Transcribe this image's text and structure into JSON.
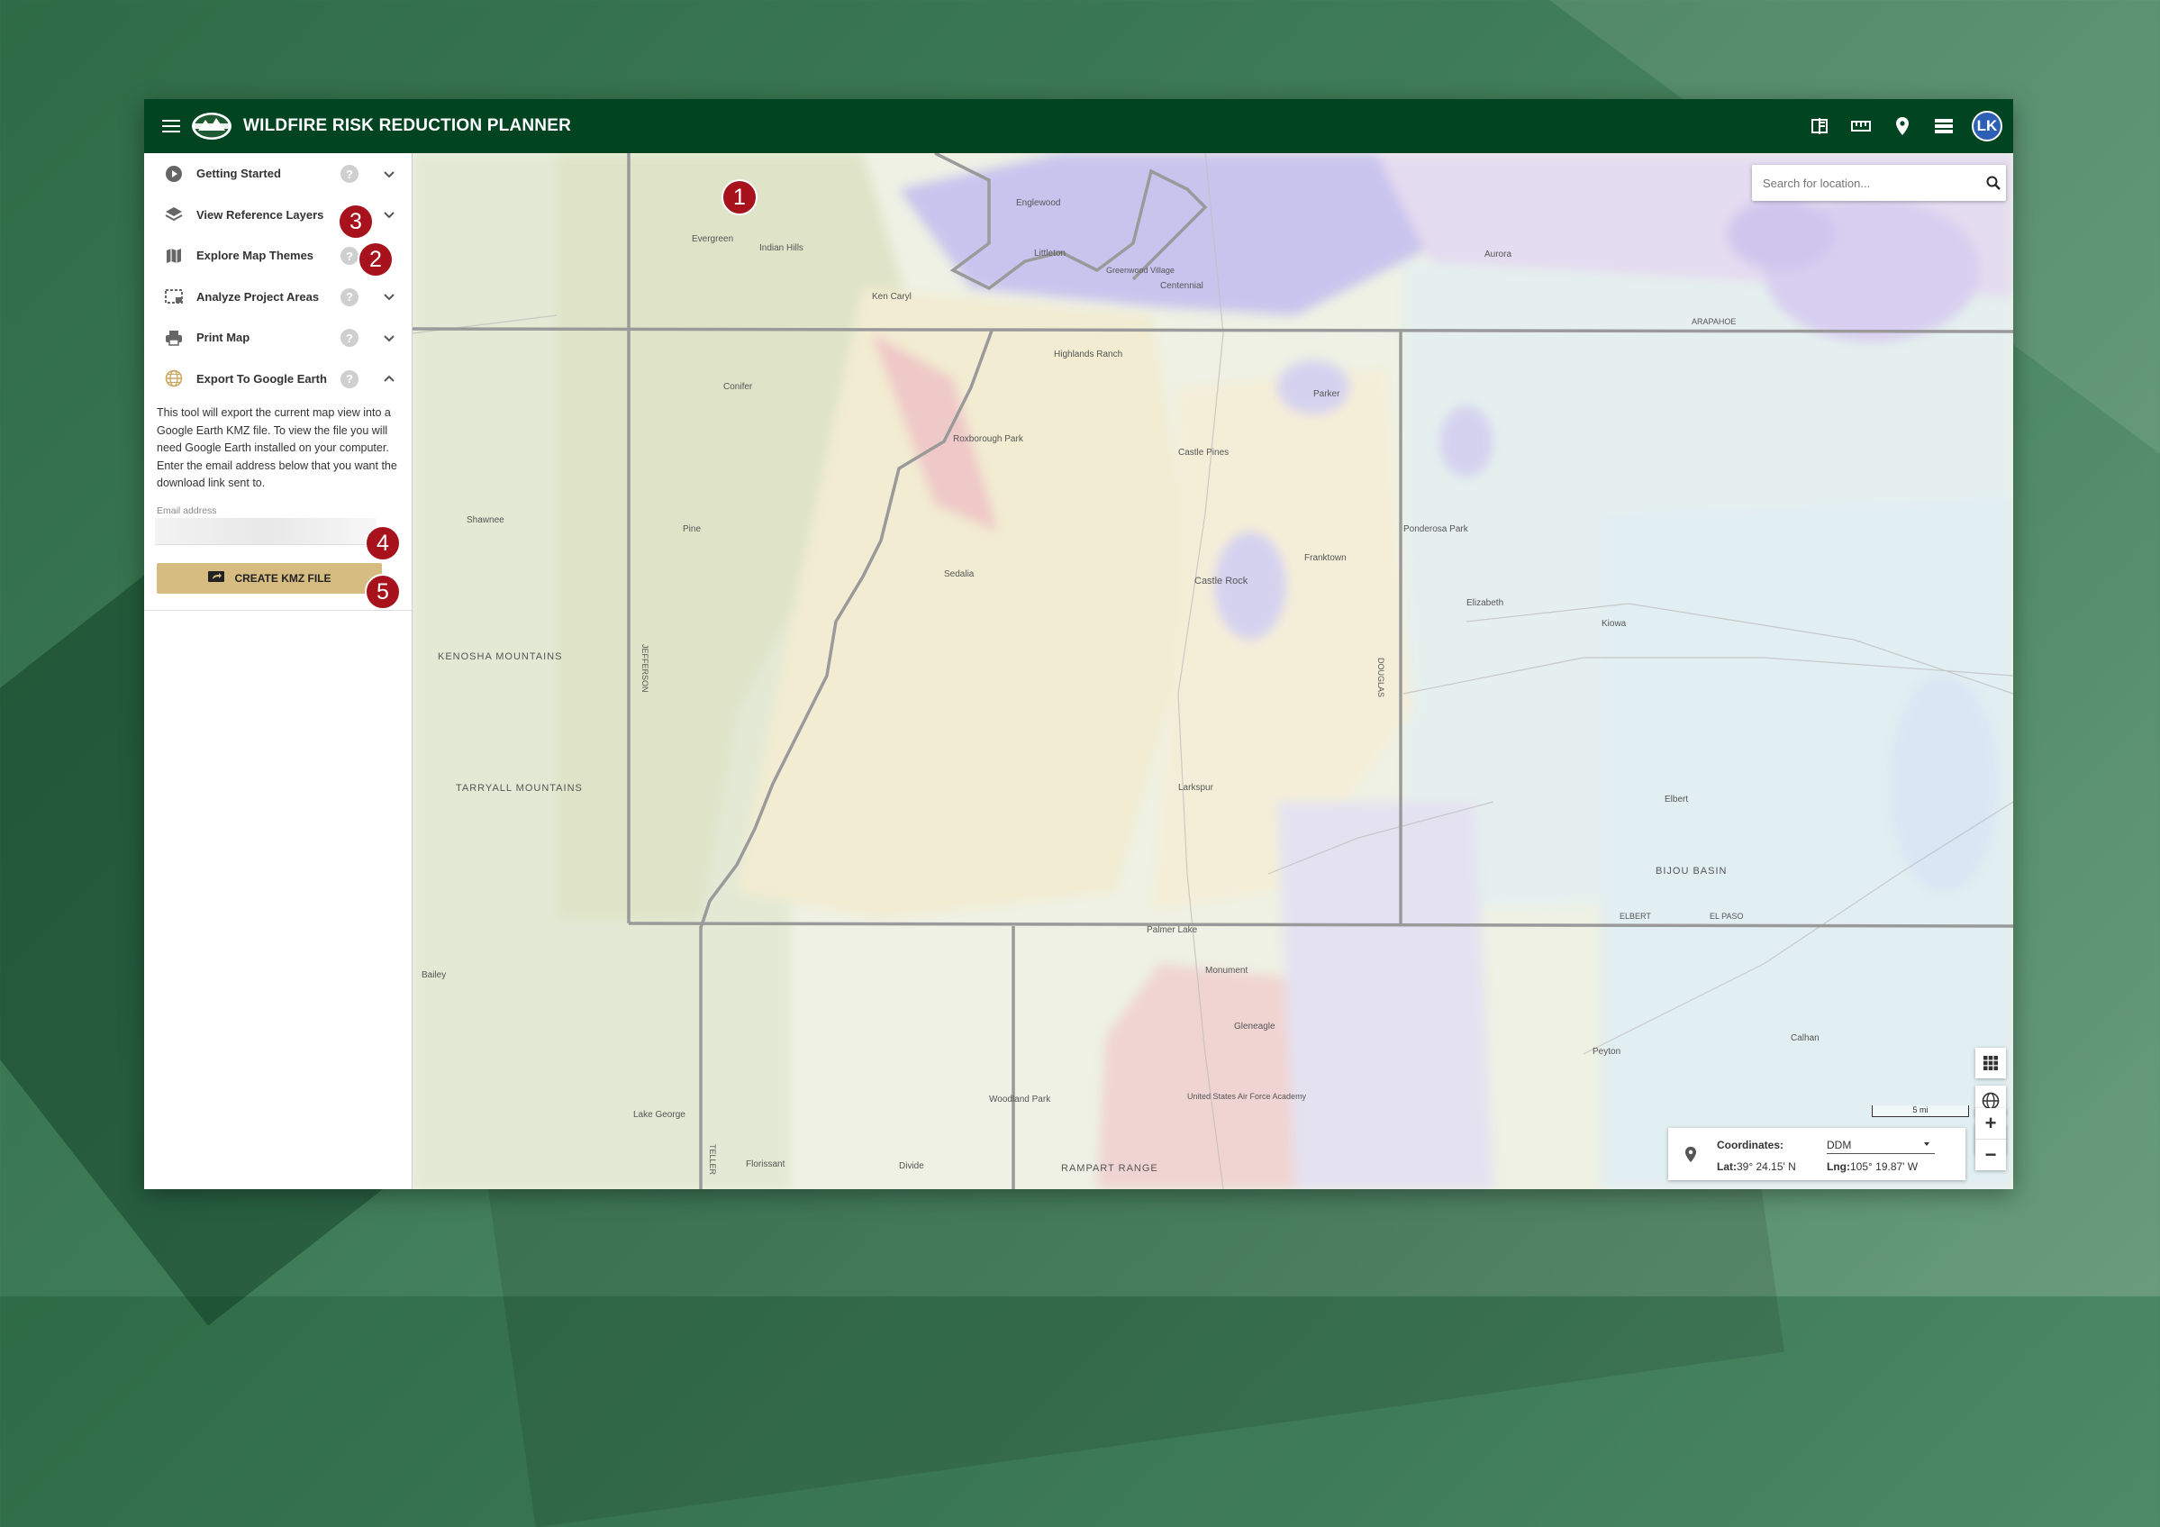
{
  "app": {
    "title": "WILDFIRE RISK REDUCTION PLANNER",
    "user_initials": "LK"
  },
  "top_icons": [
    "compare-icon",
    "ruler-icon",
    "location-pin-icon",
    "layers-list-icon"
  ],
  "sidebar": {
    "items": [
      {
        "label": "Getting Started",
        "icon": "play-circle-icon",
        "help": "?"
      },
      {
        "label": "View Reference Layers",
        "icon": "layers-icon",
        "help": "?"
      },
      {
        "label": "Explore Map Themes",
        "icon": "map-icon",
        "help": "?"
      },
      {
        "label": "Analyze Project Areas",
        "icon": "select-area-icon",
        "help": "?"
      },
      {
        "label": "Print Map",
        "icon": "printer-icon",
        "help": "?"
      },
      {
        "label": "Export To Google Earth",
        "icon": "globe-icon",
        "help": "?"
      }
    ],
    "export_panel": {
      "description": "This tool will export the current map view into a Google Earth KMZ file. To view the file you will need Google Earth installed on your computer. Enter the email address below that you want the download link sent to.",
      "email_label": "Email address",
      "email_value": "",
      "button_label": "CREATE KMZ FILE"
    }
  },
  "map": {
    "search_placeholder": "Search for location...",
    "scale_label": "5 mi",
    "coordinates": {
      "label": "Coordinates:",
      "format": "DDM",
      "lat_label": "Lat:",
      "lat_value": "39° 24.15' N",
      "lng_label": "Lng:",
      "lng_value": "105° 19.87' W"
    },
    "place_labels": [
      "Englewood",
      "Littleton",
      "Centennial",
      "Ken Caryl",
      "Highlands Ranch",
      "Parker",
      "Castle Pines",
      "Castle Rock",
      "Franktown",
      "Elizabeth",
      "Kiowa",
      "Elbert",
      "Larkspur",
      "Palmer Lake",
      "Monument",
      "Woodland Park",
      "Peyton",
      "Calhan",
      "Roxborough Park",
      "Conifer",
      "Evergreen",
      "Aurora",
      "Ponderosa Park",
      "Sedalia",
      "KENOSHA MOUNTAINS",
      "TARRYALL MOUNTAINS",
      "BIJOU BASIN",
      "RAMPART RANGE",
      "DOUGLAS",
      "ELBERT",
      "EL PASO",
      "ARAPAHOE",
      "JEFFERSON",
      "TELLER",
      "Lake George",
      "Florissant",
      "Divide",
      "Gleneagle",
      "Bailey",
      "Pine",
      "Shawnee",
      "Indian Hills",
      "Greenwood Village",
      "United States Air Force Academy"
    ]
  },
  "annotations": [
    "1",
    "2",
    "3",
    "4",
    "5"
  ],
  "colors": {
    "topbar": "#014421",
    "button": "#d7bc82",
    "badge": "#a8121d",
    "avatar": "#2d5fb4"
  }
}
